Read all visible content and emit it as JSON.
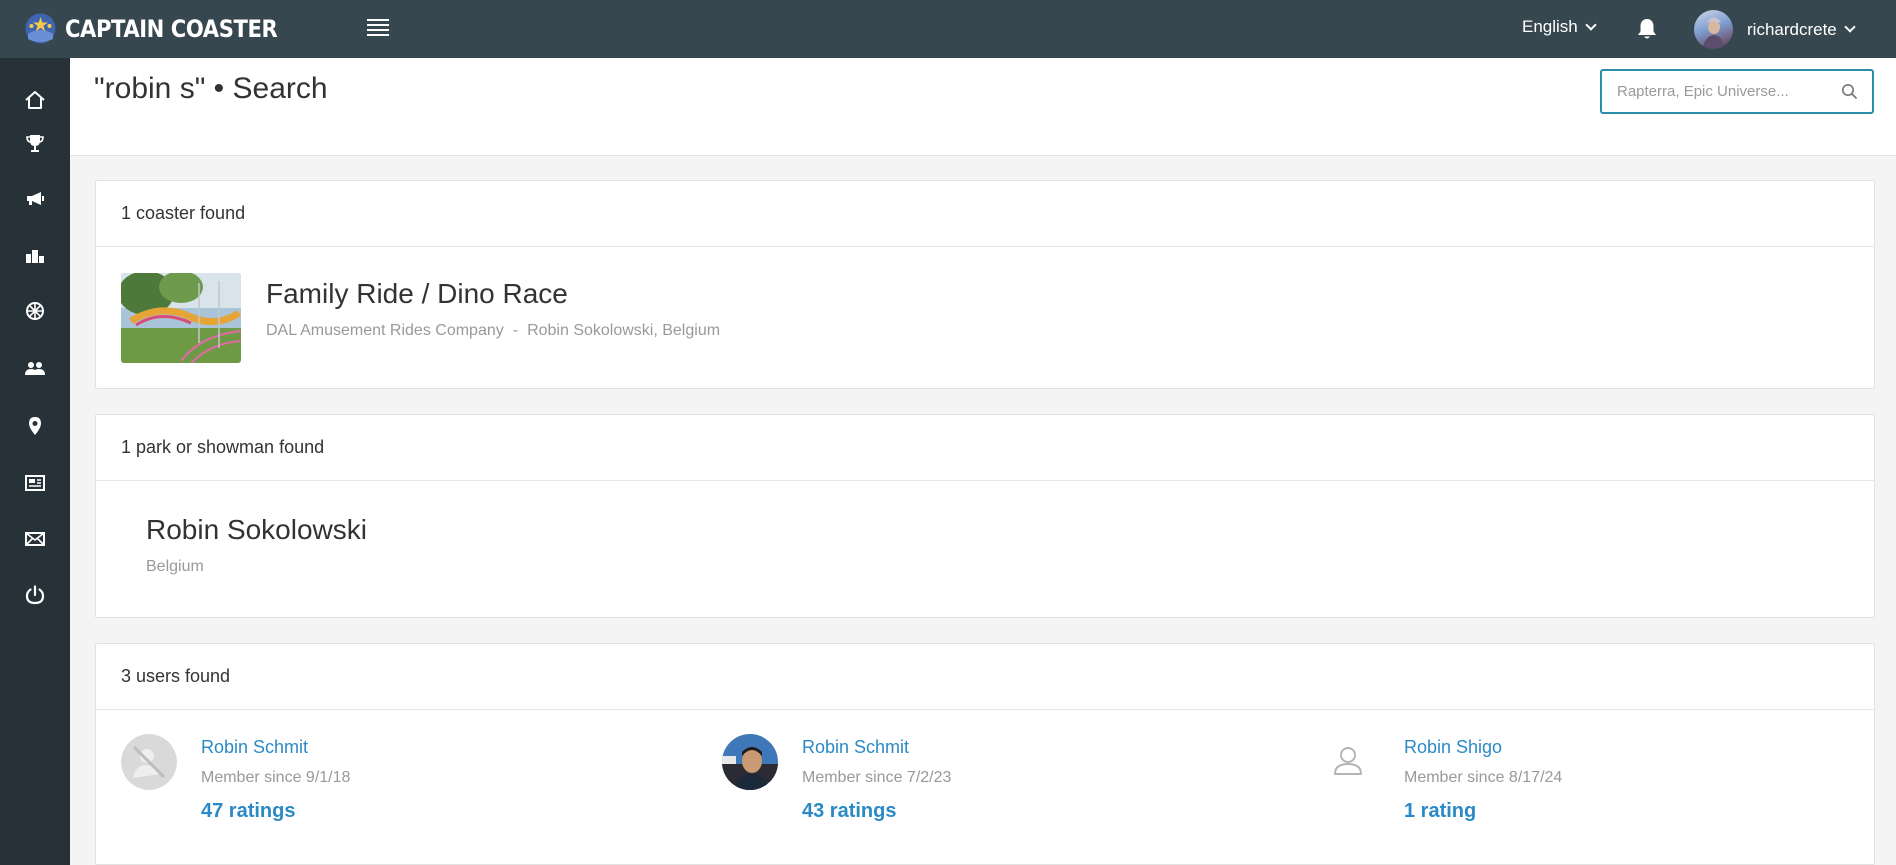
{
  "app": {
    "brand": "CAPTAIN COASTER",
    "language": "English",
    "username": "richardcrete"
  },
  "sidebar": {
    "items": [
      {
        "icon": "home-icon"
      },
      {
        "icon": "trophy-icon"
      },
      {
        "icon": "megaphone-icon"
      },
      {
        "icon": "podium-icon"
      },
      {
        "icon": "ferris-wheel-icon"
      },
      {
        "icon": "users-icon"
      },
      {
        "icon": "map-pin-icon"
      },
      {
        "icon": "newspaper-icon"
      },
      {
        "icon": "mail-icon"
      },
      {
        "icon": "power-icon"
      }
    ]
  },
  "header": {
    "title": "\"robin s\" • Search",
    "search_placeholder": "Rapterra, Epic Universe..."
  },
  "coasters": {
    "heading": "1 coaster found",
    "items": [
      {
        "name": "Family Ride / Dino Race",
        "manufacturer": "DAL Amusement Rides Company",
        "separator": "-",
        "park": "Robin Sokolowski, Belgium"
      }
    ]
  },
  "parks": {
    "heading": "1 park or showman found",
    "items": [
      {
        "name": "Robin Sokolowski",
        "country": "Belgium"
      }
    ]
  },
  "users": {
    "heading": "3 users found",
    "items": [
      {
        "name": "Robin Schmit",
        "since": "Member since 9/1/18",
        "ratings": "47 ratings"
      },
      {
        "name": "Robin Schmit",
        "since": "Member since 7/2/23",
        "ratings": "43 ratings"
      },
      {
        "name": "Robin Shigo",
        "since": "Member since 8/17/24",
        "ratings": "1 rating"
      }
    ]
  },
  "colors": {
    "topbar": "#37474f",
    "sidebar": "#263238",
    "link": "#2b8ac6",
    "search_border": "#2a8fa6"
  }
}
